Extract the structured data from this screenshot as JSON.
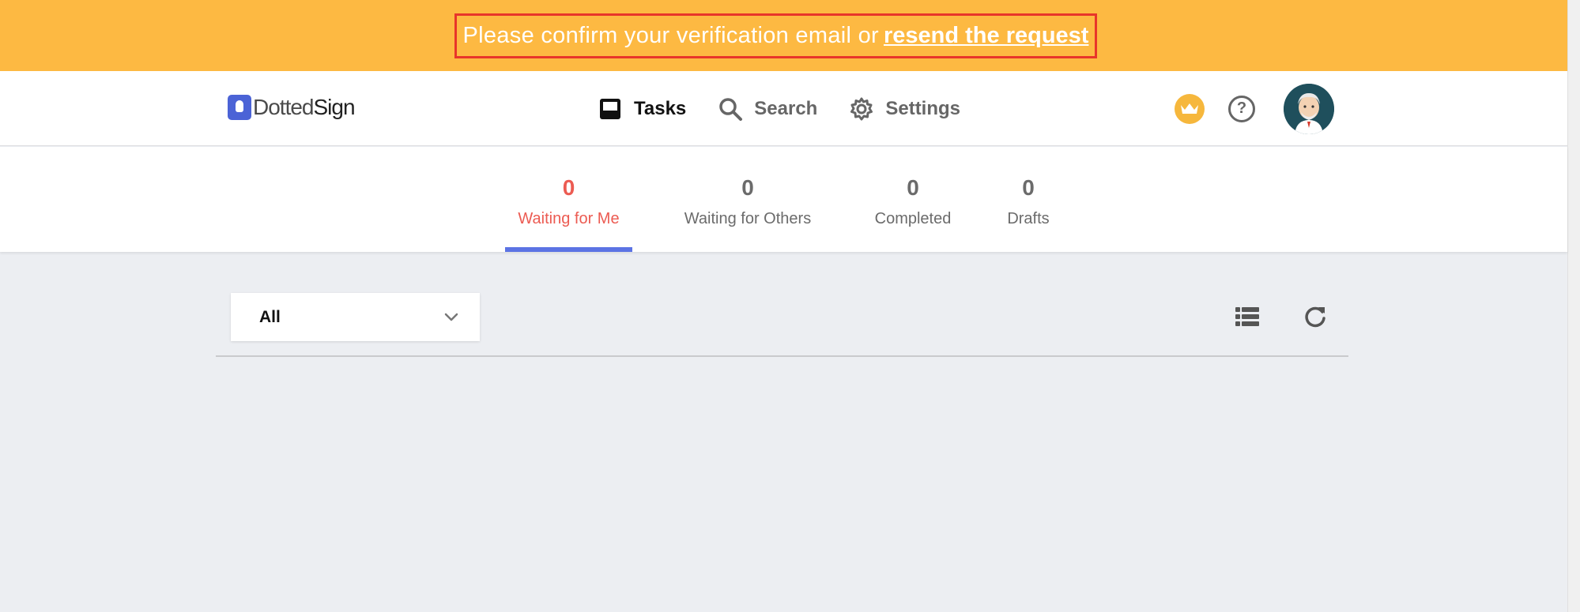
{
  "banner": {
    "message": "Please confirm your verification email or",
    "link_text": "resend the request",
    "background": "#fdb942",
    "highlight_border": "#e8352a"
  },
  "header": {
    "logo": {
      "text_light": "Dotted",
      "text_bold": "Sign"
    },
    "nav": [
      {
        "label": "Tasks",
        "icon": "inbox-icon",
        "active": true
      },
      {
        "label": "Search",
        "icon": "search-icon",
        "active": false
      },
      {
        "label": "Settings",
        "icon": "gear-icon",
        "active": false
      }
    ],
    "right_icons": [
      "crown-icon",
      "help-icon",
      "avatar"
    ]
  },
  "tabs": [
    {
      "count": "0",
      "label": "Waiting for Me",
      "active": true
    },
    {
      "count": "0",
      "label": "Waiting for Others",
      "active": false
    },
    {
      "count": "0",
      "label": "Completed",
      "active": false
    },
    {
      "count": "0",
      "label": "Drafts",
      "active": false
    }
  ],
  "toolbar": {
    "filter_value": "All",
    "view_icon": "list-view-icon",
    "refresh_icon": "refresh-icon"
  },
  "colors": {
    "active_tab_text": "#ec5b52",
    "active_tab_underline": "#5c73e4",
    "page_background": "#eceef2"
  }
}
